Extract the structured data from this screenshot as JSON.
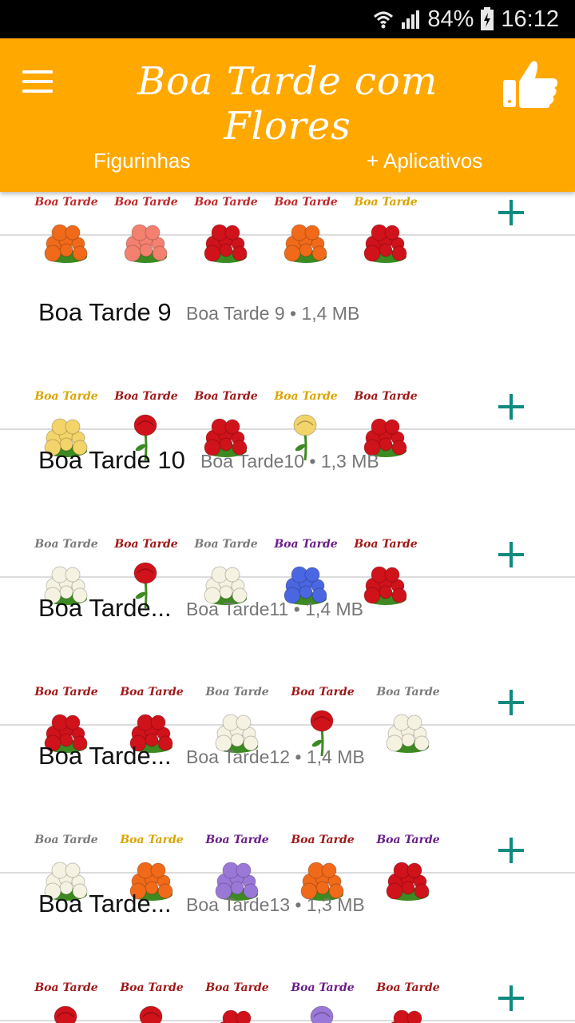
{
  "status_bar": {
    "battery": "84%",
    "time": "16:12",
    "icons": [
      "wifi-icon",
      "signal-icon",
      "battery-icon"
    ]
  },
  "app_bar": {
    "title": "Boa Tarde com Flores",
    "menu_icon": "hamburger-menu-icon",
    "like_icon": "thumbs-up-icon",
    "color": "#ffa800"
  },
  "tabs": [
    {
      "label": "Figurinhas"
    },
    {
      "label": "+ Aplicativos"
    }
  ],
  "sticker_caption": "Boa Tarde",
  "packs": [
    {
      "title": "",
      "meta": "",
      "stickers": [
        {
          "flower": "orange-tulips",
          "caption_color": "#c0292d"
        },
        {
          "flower": "pink-rose",
          "caption_color": "#c0292d"
        },
        {
          "flower": "red-rose-heart",
          "caption_color": "#c0292d"
        },
        {
          "flower": "orange-roses-bouquet",
          "caption_color": "#c0292d"
        },
        {
          "flower": "floral-arrangement",
          "caption_color": "#d9a400"
        }
      ]
    },
    {
      "title": "Boa Tarde 9",
      "meta": "Boa Tarde 9 • 1,4 MB",
      "stickers": [
        {
          "flower": "yellow-rose",
          "caption_color": "#d9a400"
        },
        {
          "flower": "red-rose-stem",
          "caption_color": "#a01818"
        },
        {
          "flower": "red-tulips",
          "caption_color": "#a01818"
        },
        {
          "flower": "yellow-rose-text",
          "caption_color": "#d9a400"
        },
        {
          "flower": "red-roses-bouquet",
          "caption_color": "#a01818"
        }
      ]
    },
    {
      "title": "Boa Tarde 10",
      "meta": "Boa Tarde10 • 1,3 MB",
      "stickers": [
        {
          "flower": "white-rose",
          "caption_color": "#7a7a7a"
        },
        {
          "flower": "red-tulip-stem",
          "caption_color": "#a01818"
        },
        {
          "flower": "white-flowers",
          "caption_color": "#7a7a7a"
        },
        {
          "flower": "blue-rose",
          "caption_color": "#6a1d8a"
        },
        {
          "flower": "red-roses-spray",
          "caption_color": "#a01818"
        }
      ]
    },
    {
      "title": "Boa Tarde...",
      "meta": "Boa Tarde11 • 1,4 MB",
      "stickers": [
        {
          "flower": "red-roses-bunch",
          "caption_color": "#a01818"
        },
        {
          "flower": "red-tulip-bouquet",
          "caption_color": "#a01818"
        },
        {
          "flower": "cream-roses-bouquet",
          "caption_color": "#7a7a7a"
        },
        {
          "flower": "single-red-rose",
          "caption_color": "#a01818"
        },
        {
          "flower": "white-roses",
          "caption_color": "#7a7a7a"
        }
      ]
    },
    {
      "title": "Boa Tarde...",
      "meta": "Boa Tarde12 • 1,4 MB",
      "stickers": [
        {
          "flower": "white-rose-leaves",
          "caption_color": "#7a7a7a"
        },
        {
          "flower": "orange-bouquet",
          "caption_color": "#d9a400"
        },
        {
          "flower": "lilac",
          "caption_color": "#6a1d8a"
        },
        {
          "flower": "orange-tulips-bunch",
          "caption_color": "#a01818"
        },
        {
          "flower": "mixed-bouquet",
          "caption_color": "#6a1d8a"
        }
      ]
    },
    {
      "title": "Boa Tarde...",
      "meta": "Boa Tarde13 • 1,3 MB",
      "stickers": [
        {
          "flower": "red-rose-large",
          "caption_color": "#a01818"
        },
        {
          "flower": "red-rose-lying",
          "caption_color": "#a01818"
        },
        {
          "flower": "red-roses-line",
          "caption_color": "#a01818"
        },
        {
          "flower": "purple-rose-text",
          "caption_color": "#6a1d8a"
        },
        {
          "flower": "red-roses-branch",
          "caption_color": "#a01818"
        }
      ]
    }
  ],
  "add_icon": "plus-icon",
  "accent_color": "#0e8a7e"
}
